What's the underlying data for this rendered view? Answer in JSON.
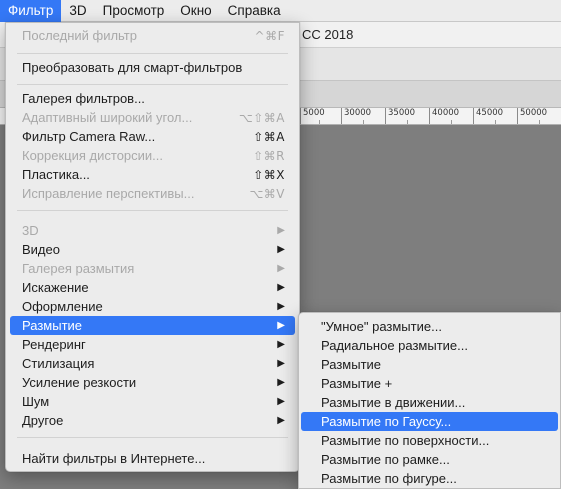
{
  "menubar": {
    "items": [
      {
        "label": "Фильтр",
        "active": true
      },
      {
        "label": "3D",
        "active": false
      },
      {
        "label": "Просмотр",
        "active": false
      },
      {
        "label": "Окно",
        "active": false
      },
      {
        "label": "Справка",
        "active": false
      }
    ]
  },
  "doc_title": "CC 2018",
  "ruler": {
    "labels": [
      "5000",
      "30000",
      "35000",
      "40000",
      "45000",
      "50000"
    ]
  },
  "filter_menu": {
    "items": [
      {
        "label": "Последний фильтр",
        "shortcut": "^⌘F",
        "disabled": true
      },
      {
        "label": "Преобразовать для смарт-фильтров",
        "shortcut": "",
        "disabled": false
      },
      {
        "label": "Галерея фильтров...",
        "shortcut": "",
        "disabled": false
      },
      {
        "label": "Адаптивный широкий угол...",
        "shortcut": "⌥⇧⌘A",
        "disabled": true
      },
      {
        "label": "Фильтр Camera Raw...",
        "shortcut": "⇧⌘A",
        "disabled": false
      },
      {
        "label": "Коррекция дисторсии...",
        "shortcut": "⇧⌘R",
        "disabled": true
      },
      {
        "label": "Пластика...",
        "shortcut": "⇧⌘X",
        "disabled": false
      },
      {
        "label": "Исправление перспективы...",
        "shortcut": "⌥⌘V",
        "disabled": true
      },
      {
        "label": "3D",
        "submenu": true,
        "disabled": true
      },
      {
        "label": "Видео",
        "submenu": true,
        "disabled": false
      },
      {
        "label": "Галерея размытия",
        "submenu": true,
        "disabled": true
      },
      {
        "label": "Искажение",
        "submenu": true,
        "disabled": false
      },
      {
        "label": "Оформление",
        "submenu": true,
        "disabled": false
      },
      {
        "label": "Размытие",
        "submenu": true,
        "disabled": false,
        "highlighted": true
      },
      {
        "label": "Рендеринг",
        "submenu": true,
        "disabled": false
      },
      {
        "label": "Стилизация",
        "submenu": true,
        "disabled": false
      },
      {
        "label": "Усиление резкости",
        "submenu": true,
        "disabled": false
      },
      {
        "label": "Шум",
        "submenu": true,
        "disabled": false
      },
      {
        "label": "Другое",
        "submenu": true,
        "disabled": false
      },
      {
        "label": "Найти фильтры в Интернете...",
        "shortcut": "",
        "disabled": false
      }
    ]
  },
  "blur_submenu": {
    "items": [
      {
        "label": "\"Умное\" размытие..."
      },
      {
        "label": "Радиальное размытие..."
      },
      {
        "label": "Размытие"
      },
      {
        "label": "Размытие +"
      },
      {
        "label": "Размытие в движении..."
      },
      {
        "label": "Размытие по Гауссу...",
        "highlighted": true
      },
      {
        "label": "Размытие по поверхности..."
      },
      {
        "label": "Размытие по рамке..."
      },
      {
        "label": "Размытие по фигуре..."
      }
    ]
  },
  "icons": {
    "submenu_arrow": "triangle-right-icon"
  },
  "colors": {
    "highlight": "#3478f6",
    "menu_bg": "#ececec",
    "disabled_text": "#a9a9a9",
    "canvas": "#7e7e7e"
  }
}
